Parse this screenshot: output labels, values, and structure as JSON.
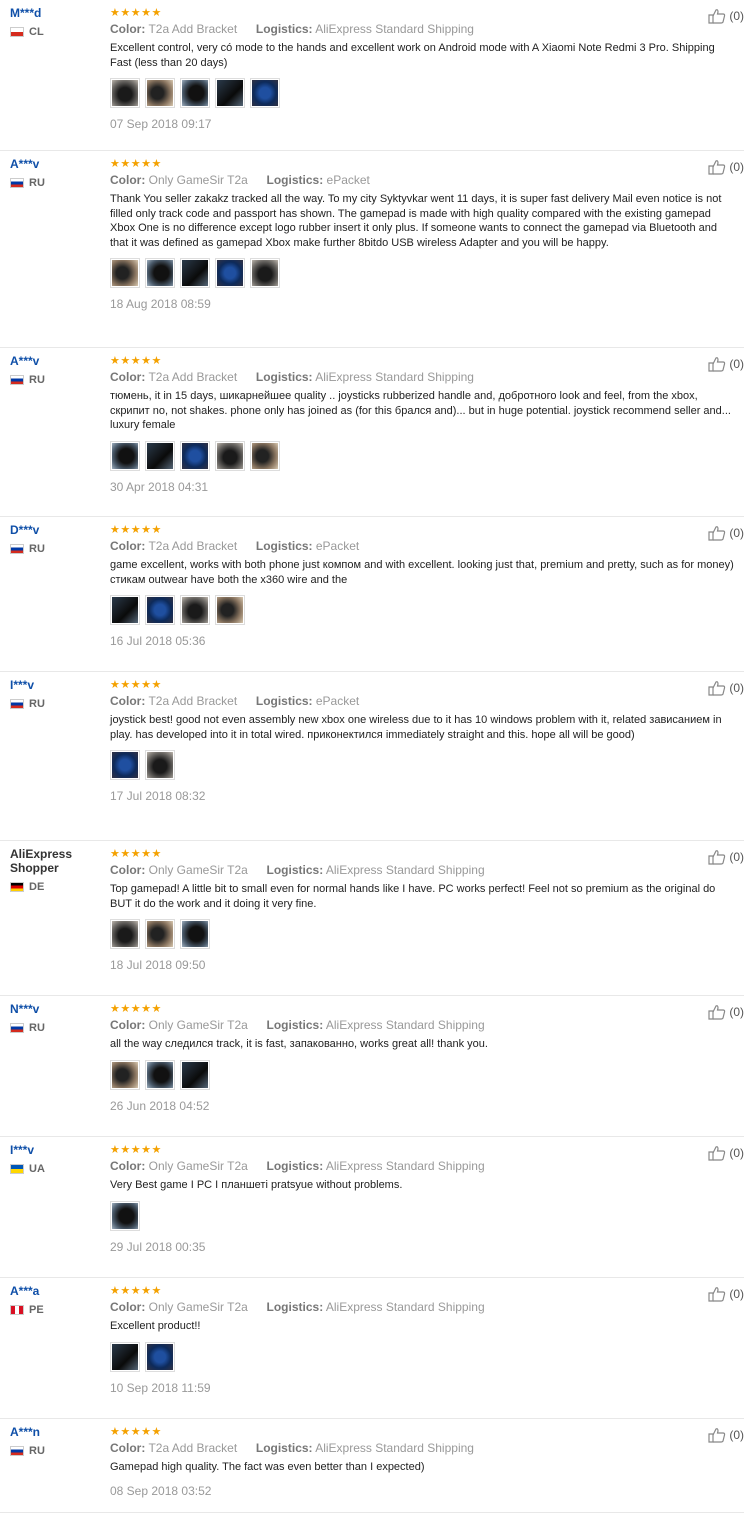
{
  "reviews": [
    {
      "user": "M***d",
      "country": "CL",
      "flag": [
        "#0039a6",
        "#fff",
        "#d52b1e"
      ],
      "color": "T2a Add Bracket",
      "logistics": "AliExpress Standard Shipping",
      "text": "Excellent control, very có mode to the hands and excellent work on Android mode with A Xiaomi Note Redmi 3 Pro. Shipping Fast (less than 20 days)",
      "photos": 5,
      "date": "07 Sep 2018 09:17",
      "likes": "(0)"
    },
    {
      "user": "A***v",
      "country": "RU",
      "flag": [
        "#fff",
        "#0039a6",
        "#d52b1e"
      ],
      "color": "Only GameSir T2a",
      "logistics": "ePacket",
      "text": "Thank You seller zakakz tracked all the way. To my city Syktyvkar went 11 days, it is super fast delivery Mail even notice is not filled only track code and passport has shown. The gamepad is made with high quality compared with the existing gamepad Xbox One is no difference except logo rubber insert it only plus. If someone wants to connect the gamepad via Bluetooth and that it was defined as gamepad Xbox make further 8bitdo USB wireless Adapter and you will be happy.",
      "photos": 5,
      "date": "18 Aug 2018 08:59",
      "likes": "(0)"
    },
    {
      "user": "A***v",
      "country": "RU",
      "flag": [
        "#fff",
        "#0039a6",
        "#d52b1e"
      ],
      "color": "T2a Add Bracket",
      "logistics": "AliExpress Standard Shipping",
      "text": "тюмень, it in 15 days, шикарнейшее quality .. joysticks rubberized handle and, добротного look and feel, from the xbox, скрипит no, not shakes. phone only has joined as (for this брался and)... but in huge potential. joystick recommend seller and... luxury female",
      "photos": 5,
      "date": "30 Apr 2018 04:31",
      "likes": "(0)"
    },
    {
      "user": "D***v",
      "country": "RU",
      "flag": [
        "#fff",
        "#0039a6",
        "#d52b1e"
      ],
      "color": "T2a Add Bracket",
      "logistics": "ePacket",
      "text": "game excellent, works with both phone just компом and with excellent. looking just that, premium and pretty, such as for money) стикам outwear have both the x360 wire and the",
      "photos": 4,
      "date": "16 Jul 2018 05:36",
      "likes": "(0)"
    },
    {
      "user": "I***v",
      "country": "RU",
      "flag": [
        "#fff",
        "#0039a6",
        "#d52b1e"
      ],
      "color": "T2a Add Bracket",
      "logistics": "ePacket",
      "text": "joystick best! good not even assembly new xbox one wireless due to it has 10 windows problem with it, related зависанием in play. has developed into it in total wired. приконектился immediately straight and this. hope all will be good)",
      "photos": 2,
      "date": "17 Jul 2018 08:32",
      "likes": "(0)"
    },
    {
      "user": "AliExpress Shopper",
      "country": "DE",
      "flag": [
        "#000",
        "#dd0000",
        "#ffce00"
      ],
      "color": "Only GameSir T2a",
      "logistics": "AliExpress Standard Shipping",
      "text": "Top gamepad! A little bit to small even for normal hands like I have. PC works perfect! Feel not so premium as the original do BUT it do the work and it doing it very fine.",
      "photos": 3,
      "date": "18 Jul 2018 09:50",
      "likes": "(0)"
    },
    {
      "user": "N***v",
      "country": "RU",
      "flag": [
        "#fff",
        "#0039a6",
        "#d52b1e"
      ],
      "color": "Only GameSir T2a",
      "logistics": "AliExpress Standard Shipping",
      "text": "all the way следился track, it is fast, запакованно, works great all! thank you.",
      "photos": 3,
      "date": "26 Jun 2018 04:52",
      "likes": "(0)"
    },
    {
      "user": "I***v",
      "country": "UA",
      "flag": [
        "#0057b7",
        "#ffd700"
      ],
      "color": "Only GameSir T2a",
      "logistics": "AliExpress Standard Shipping",
      "text": "Very Best game I PC I планшеті pratsyue without problems.",
      "photos": 1,
      "date": "29 Jul 2018 00:35",
      "likes": "(0)"
    },
    {
      "user": "A***a",
      "country": "PE",
      "flag": [
        "#d91023",
        "#fff",
        "#d91023"
      ],
      "color": "Only GameSir T2a",
      "logistics": "AliExpress Standard Shipping",
      "text": "Excellent product!!",
      "photos": 2,
      "date": "10 Sep 2018 11:59",
      "likes": "(0)"
    },
    {
      "user": "A***n",
      "country": "RU",
      "flag": [
        "#fff",
        "#0039a6",
        "#d52b1e"
      ],
      "color": "T2a Add Bracket",
      "logistics": "AliExpress Standard Shipping",
      "text": "Gamepad high quality. The fact was even better than I expected)",
      "photos": 0,
      "date": "08 Sep 2018 03:52",
      "likes": "(0)"
    }
  ],
  "labels": {
    "color": "Color:",
    "logistics": "Logistics:"
  },
  "stars": "★★★★★",
  "colors": {
    "star": "#f4a100",
    "username": "#0f4fa8"
  }
}
